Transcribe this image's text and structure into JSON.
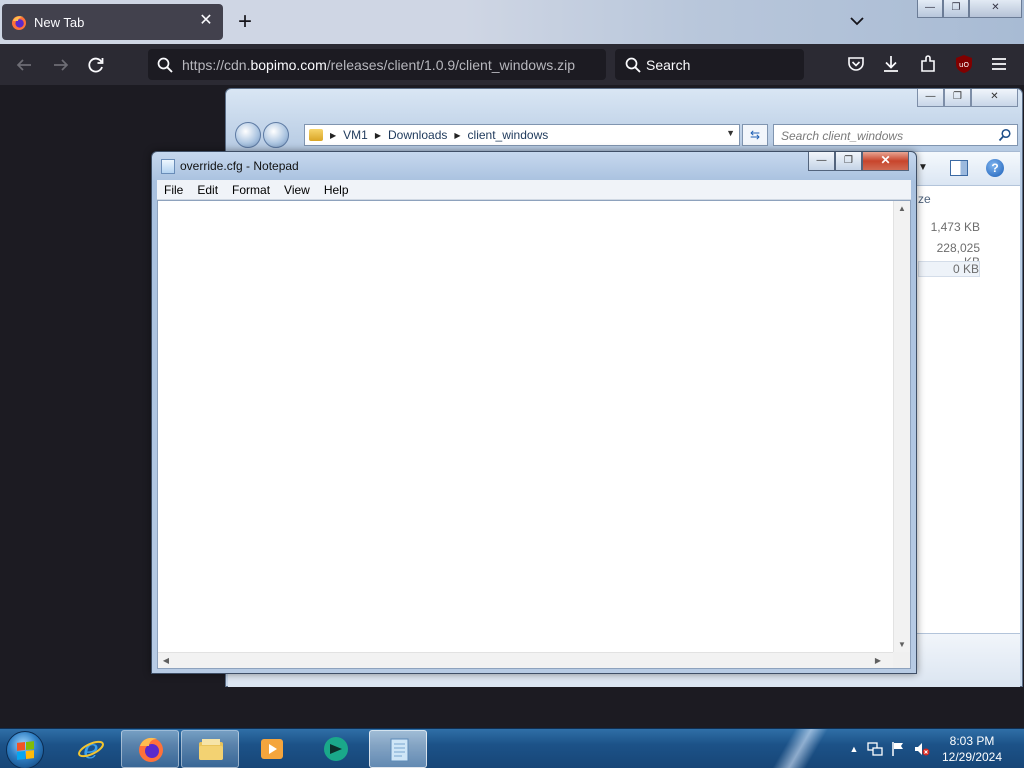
{
  "browser": {
    "tab": {
      "title": "New Tab",
      "close_glyph": "✕",
      "icon": "firefox-icon"
    },
    "new_tab_glyph": "+",
    "url": {
      "prefix": "https://cdn.",
      "host": "bopimo.com",
      "path": "/releases/client/1.0.9/client_windows.zip"
    },
    "search_placeholder": "Search",
    "window_buttons": {
      "minimize": "—",
      "maximize": "❐",
      "close": "✕"
    },
    "colors": {
      "tab_bg": "#42414d",
      "toolbar_bg": "#2b2a33",
      "field_bg": "#1c1b22",
      "content_bg": "#1c1b22",
      "ublock_red": "#800000"
    }
  },
  "explorer": {
    "breadcrumb": [
      "VM1",
      "Downloads",
      "client_windows"
    ],
    "search_placeholder": "Search client_windows",
    "column_header_fragment": "ze",
    "sizes": [
      "1,473 KB",
      "228,025 KB",
      "0 KB"
    ],
    "window_buttons": {
      "minimize": "—",
      "maximize": "❐",
      "close": "✕"
    },
    "help_glyph": "?"
  },
  "notepad": {
    "title": "override.cfg - Notepad",
    "menu": [
      "File",
      "Edit",
      "Format",
      "View",
      "Help"
    ],
    "content": "",
    "window_buttons": {
      "minimize": "—",
      "maximize": "❐",
      "close": "✕"
    },
    "scroll": {
      "up": "▲",
      "down": "▼",
      "left": "◀",
      "right": "▶"
    }
  },
  "taskbar": {
    "items": [
      {
        "name": "internet-explorer",
        "icon": "ie-icon"
      },
      {
        "name": "firefox",
        "icon": "firefox-icon"
      },
      {
        "name": "file-explorer",
        "icon": "folder-icon"
      },
      {
        "name": "media-player",
        "icon": "media-player-icon"
      },
      {
        "name": "app-teal",
        "icon": "teal-app-icon"
      },
      {
        "name": "notepad",
        "icon": "notepad-icon"
      }
    ],
    "tray": {
      "chevron": "▲"
    },
    "clock": {
      "time": "8:03 PM",
      "date": "12/29/2024"
    }
  }
}
